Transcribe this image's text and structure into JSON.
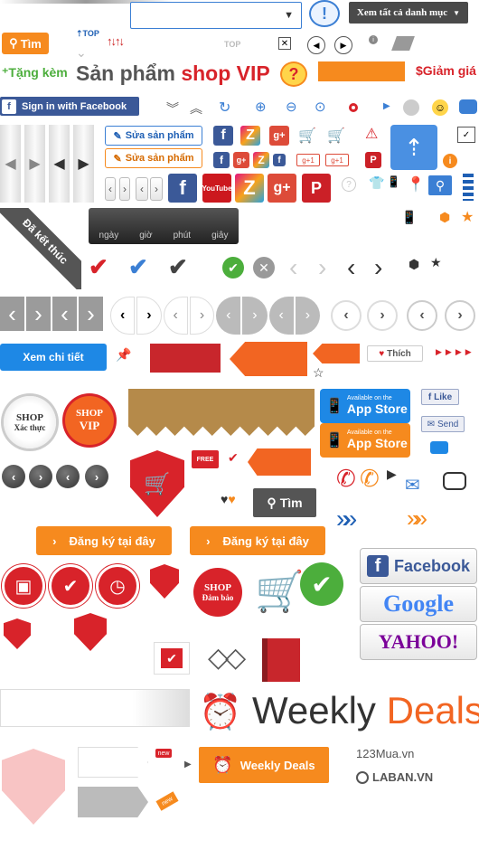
{
  "top": {
    "search_button": "Tìm",
    "top_label": "TOP",
    "top_label_gray": "TOP",
    "all_categories": "Xem tất cả danh mục",
    "help_mark": "!"
  },
  "promo": {
    "gift_label": "Tặng kèm",
    "vip_title_prefix": "Sản phẩm ",
    "vip_title_highlight": "shop VIP",
    "discount_label": "Giảm giá"
  },
  "facebook_signin": "Sign in with Facebook",
  "edit_buttons": {
    "edit_blue": "Sửa sản phẩm",
    "edit_orange": "Sửa sản phẩm"
  },
  "ended_ribbon": "Đã kết thúc",
  "countdown": {
    "units": [
      "ngày",
      "giờ",
      "phút",
      "giây"
    ]
  },
  "detail_button": "Xem chi tiết",
  "like_button": "Thích",
  "shop_badges": {
    "verified_line1": "SHOP",
    "verified_line2": "Xác thực",
    "vip_line1": "SHOP",
    "vip_line2": "VIP",
    "assured_line1": "SHOP",
    "assured_line2": "Đảm bảo"
  },
  "stores": {
    "available_on": "Available on the",
    "app_store": "App Store"
  },
  "fb_like": "Like",
  "send_label": "Send",
  "free_label": "FREE",
  "search_dark": "Tìm",
  "register_buttons": [
    "Đăng ký tại đây",
    "Đăng ký tại đây"
  ],
  "brand_buttons": {
    "facebook": "Facebook",
    "google": "Google",
    "yahoo": "YAHOO!"
  },
  "weekly": {
    "big_word1": "Weekly",
    "big_word2": "Deals",
    "small_label": "Weekly Deals"
  },
  "new_tags": [
    "new",
    "new"
  ],
  "sites": {
    "site1": "123Mua.vn",
    "site2": "LABAN.VN"
  },
  "colors": {
    "orange": "#f68a1e",
    "red": "#d8232a",
    "fb_blue": "#3b5998",
    "green": "#4cae3c",
    "blue": "#1e88e5"
  }
}
